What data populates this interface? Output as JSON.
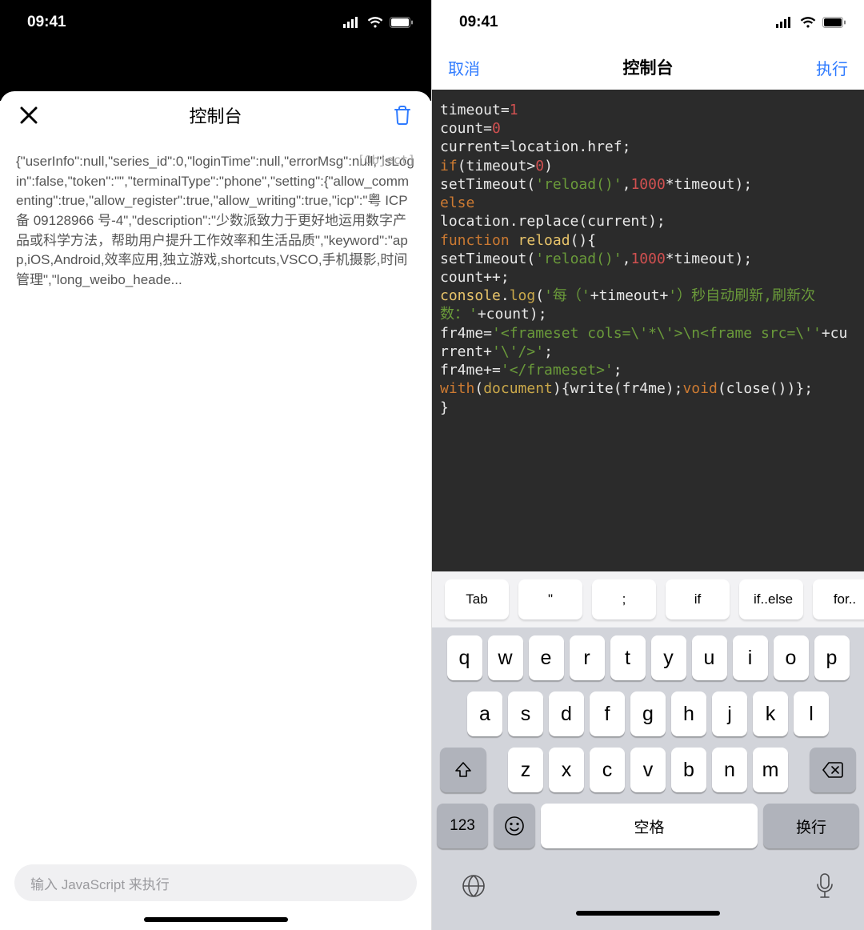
{
  "status_bar": {
    "time": "09:41"
  },
  "left": {
    "title": "控制台",
    "object_tag": "[Object]",
    "output_text": "{\"userInfo\":null,\"series_id\":0,\"loginTime\":null,\"errorMsg\":null,\"isLogin\":false,\"token\":\"\",\"terminalType\":\"phone\",\"setting\":{\"allow_commenting\":true,\"allow_register\":true,\"allow_writing\":true,\"icp\":\"粤 ICP 备 09128966 号-4\",\"description\":\"少数派致力于更好地运用数字产品或科学方法，帮助用户提升工作效率和生活品质\",\"keyword\":\"app,iOS,Android,效率应用,独立游戏,shortcuts,VSCO,手机摄影,时间管理\",\"long_weibo_heade...",
    "input_placeholder": "输入 JavaScript 来执行"
  },
  "right": {
    "nav": {
      "cancel": "取消",
      "title": "控制台",
      "run": "执行"
    },
    "code_tokens": [
      [
        "wht",
        "timeout="
      ],
      [
        "num",
        "1"
      ],
      [
        "br"
      ],
      [
        "wht",
        "count="
      ],
      [
        "num",
        "0"
      ],
      [
        "br"
      ],
      [
        "wht",
        "current=location.href;"
      ],
      [
        "br"
      ],
      [
        "kw",
        "if"
      ],
      [
        "wht",
        "(timeout>"
      ],
      [
        "num",
        "0"
      ],
      [
        "wht",
        ")"
      ],
      [
        "br"
      ],
      [
        "wht",
        "setTimeout("
      ],
      [
        "str",
        "'reload()'"
      ],
      [
        "wht",
        ","
      ],
      [
        "num",
        "1000"
      ],
      [
        "wht",
        "*timeout);"
      ],
      [
        "br"
      ],
      [
        "kw",
        "else"
      ],
      [
        "br"
      ],
      [
        "wht",
        "location.replace(current);"
      ],
      [
        "br"
      ],
      [
        "kw",
        "function"
      ],
      [
        "wht",
        " "
      ],
      [
        "fn",
        "reload"
      ],
      [
        "wht",
        "(){"
      ],
      [
        "br"
      ],
      [
        "wht",
        "setTimeout("
      ],
      [
        "str",
        "'reload()'"
      ],
      [
        "wht",
        ","
      ],
      [
        "num",
        "1000"
      ],
      [
        "wht",
        "*timeout);"
      ],
      [
        "br"
      ],
      [
        "wht",
        "count++;"
      ],
      [
        "br"
      ],
      [
        "fn",
        "console"
      ],
      [
        "wht",
        "."
      ],
      [
        "name",
        "log"
      ],
      [
        "wht",
        "("
      ],
      [
        "str",
        "'每（'"
      ],
      [
        "wht",
        "+timeout+"
      ],
      [
        "str",
        "'）秒自动刷新,刷新次数：'"
      ],
      [
        "wht",
        "+count);"
      ],
      [
        "br"
      ],
      [
        "wht",
        "fr4me="
      ],
      [
        "str",
        "'<frameset cols=\\'*\\'>\\n<frame src=\\''"
      ],
      [
        "wht",
        "+current+"
      ],
      [
        "str",
        "'\\'/>'"
      ],
      [
        "wht",
        ";"
      ],
      [
        "br"
      ],
      [
        "wht",
        "fr4me+="
      ],
      [
        "str",
        "'</frameset>'"
      ],
      [
        "wht",
        ";"
      ],
      [
        "br"
      ],
      [
        "kw",
        "with"
      ],
      [
        "wht",
        "("
      ],
      [
        "name",
        "document"
      ],
      [
        "wht",
        "){write(fr4me);"
      ],
      [
        "kw",
        "void"
      ],
      [
        "wht",
        "(close())};"
      ],
      [
        "br"
      ],
      [
        "wht",
        "}"
      ]
    ],
    "accessory": [
      "Tab",
      "\"",
      ";",
      "if",
      "if..else",
      "for.."
    ],
    "keyboard": {
      "row1": [
        "q",
        "w",
        "e",
        "r",
        "t",
        "y",
        "u",
        "i",
        "o",
        "p"
      ],
      "row2": [
        "a",
        "s",
        "d",
        "f",
        "g",
        "h",
        "j",
        "k",
        "l"
      ],
      "row3": [
        "z",
        "x",
        "c",
        "v",
        "b",
        "n",
        "m"
      ],
      "num_key": "123",
      "space": "空格",
      "return": "换行"
    }
  }
}
